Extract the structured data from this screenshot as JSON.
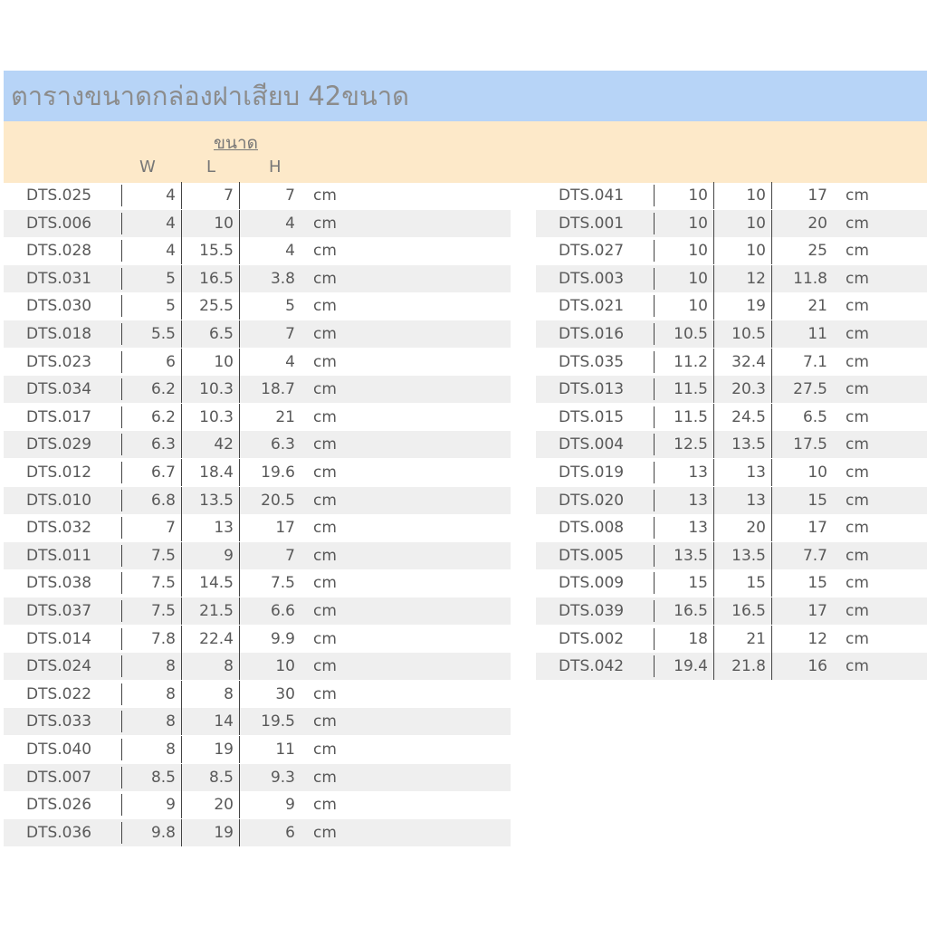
{
  "title": "ตารางขนาดกล่องฝาเสียบ 42ขนาด",
  "header": {
    "size_label": "ขนาด",
    "col_w": "W",
    "col_l": "L",
    "col_h": "H"
  },
  "left_rows": [
    {
      "code": "DTS.025",
      "w": "4",
      "l": "7",
      "h": "7",
      "unit": "cm"
    },
    {
      "code": "DTS.006",
      "w": "4",
      "l": "10",
      "h": "4",
      "unit": "cm"
    },
    {
      "code": "DTS.028",
      "w": "4",
      "l": "15.5",
      "h": "4",
      "unit": "cm"
    },
    {
      "code": "DTS.031",
      "w": "5",
      "l": "16.5",
      "h": "3.8",
      "unit": "cm"
    },
    {
      "code": "DTS.030",
      "w": "5",
      "l": "25.5",
      "h": "5",
      "unit": "cm"
    },
    {
      "code": "DTS.018",
      "w": "5.5",
      "l": "6.5",
      "h": "7",
      "unit": "cm"
    },
    {
      "code": "DTS.023",
      "w": "6",
      "l": "10",
      "h": "4",
      "unit": "cm"
    },
    {
      "code": "DTS.034",
      "w": "6.2",
      "l": "10.3",
      "h": "18.7",
      "unit": "cm"
    },
    {
      "code": "DTS.017",
      "w": "6.2",
      "l": "10.3",
      "h": "21",
      "unit": "cm"
    },
    {
      "code": "DTS.029",
      "w": "6.3",
      "l": "42",
      "h": "6.3",
      "unit": "cm"
    },
    {
      "code": "DTS.012",
      "w": "6.7",
      "l": "18.4",
      "h": "19.6",
      "unit": "cm"
    },
    {
      "code": "DTS.010",
      "w": "6.8",
      "l": "13.5",
      "h": "20.5",
      "unit": "cm"
    },
    {
      "code": "DTS.032",
      "w": "7",
      "l": "13",
      "h": "17",
      "unit": "cm"
    },
    {
      "code": "DTS.011",
      "w": "7.5",
      "l": "9",
      "h": "7",
      "unit": "cm"
    },
    {
      "code": "DTS.038",
      "w": "7.5",
      "l": "14.5",
      "h": "7.5",
      "unit": "cm"
    },
    {
      "code": "DTS.037",
      "w": "7.5",
      "l": "21.5",
      "h": "6.6",
      "unit": "cm"
    },
    {
      "code": "DTS.014",
      "w": "7.8",
      "l": "22.4",
      "h": "9.9",
      "unit": "cm"
    },
    {
      "code": "DTS.024",
      "w": "8",
      "l": "8",
      "h": "10",
      "unit": "cm"
    },
    {
      "code": "DTS.022",
      "w": "8",
      "l": "8",
      "h": "30",
      "unit": "cm"
    },
    {
      "code": "DTS.033",
      "w": "8",
      "l": "14",
      "h": "19.5",
      "unit": "cm"
    },
    {
      "code": "DTS.040",
      "w": "8",
      "l": "19",
      "h": "11",
      "unit": "cm"
    },
    {
      "code": "DTS.007",
      "w": "8.5",
      "l": "8.5",
      "h": "9.3",
      "unit": "cm"
    },
    {
      "code": "DTS.026",
      "w": "9",
      "l": "20",
      "h": "9",
      "unit": "cm"
    },
    {
      "code": "DTS.036",
      "w": "9.8",
      "l": "19",
      "h": "6",
      "unit": "cm"
    }
  ],
  "right_rows": [
    {
      "code": "DTS.041",
      "w": "10",
      "l": "10",
      "h": "17",
      "unit": "cm"
    },
    {
      "code": "DTS.001",
      "w": "10",
      "l": "10",
      "h": "20",
      "unit": "cm"
    },
    {
      "code": "DTS.027",
      "w": "10",
      "l": "10",
      "h": "25",
      "unit": "cm"
    },
    {
      "code": "DTS.003",
      "w": "10",
      "l": "12",
      "h": "11.8",
      "unit": "cm"
    },
    {
      "code": "DTS.021",
      "w": "10",
      "l": "19",
      "h": "21",
      "unit": "cm"
    },
    {
      "code": "DTS.016",
      "w": "10.5",
      "l": "10.5",
      "h": "11",
      "unit": "cm"
    },
    {
      "code": "DTS.035",
      "w": "11.2",
      "l": "32.4",
      "h": "7.1",
      "unit": "cm"
    },
    {
      "code": "DTS.013",
      "w": "11.5",
      "l": "20.3",
      "h": "27.5",
      "unit": "cm"
    },
    {
      "code": "DTS.015",
      "w": "11.5",
      "l": "24.5",
      "h": "6.5",
      "unit": "cm"
    },
    {
      "code": "DTS.004",
      "w": "12.5",
      "l": "13.5",
      "h": "17.5",
      "unit": "cm"
    },
    {
      "code": "DTS.019",
      "w": "13",
      "l": "13",
      "h": "10",
      "unit": "cm"
    },
    {
      "code": "DTS.020",
      "w": "13",
      "l": "13",
      "h": "15",
      "unit": "cm"
    },
    {
      "code": "DTS.008",
      "w": "13",
      "l": "20",
      "h": "17",
      "unit": "cm"
    },
    {
      "code": "DTS.005",
      "w": "13.5",
      "l": "13.5",
      "h": "7.7",
      "unit": "cm"
    },
    {
      "code": "DTS.009",
      "w": "15",
      "l": "15",
      "h": "15",
      "unit": "cm"
    },
    {
      "code": "DTS.039",
      "w": "16.5",
      "l": "16.5",
      "h": "17",
      "unit": "cm"
    },
    {
      "code": "DTS.002",
      "w": "18",
      "l": "21",
      "h": "12",
      "unit": "cm"
    },
    {
      "code": "DTS.042",
      "w": "19.4",
      "l": "21.8",
      "h": "16",
      "unit": "cm"
    }
  ]
}
